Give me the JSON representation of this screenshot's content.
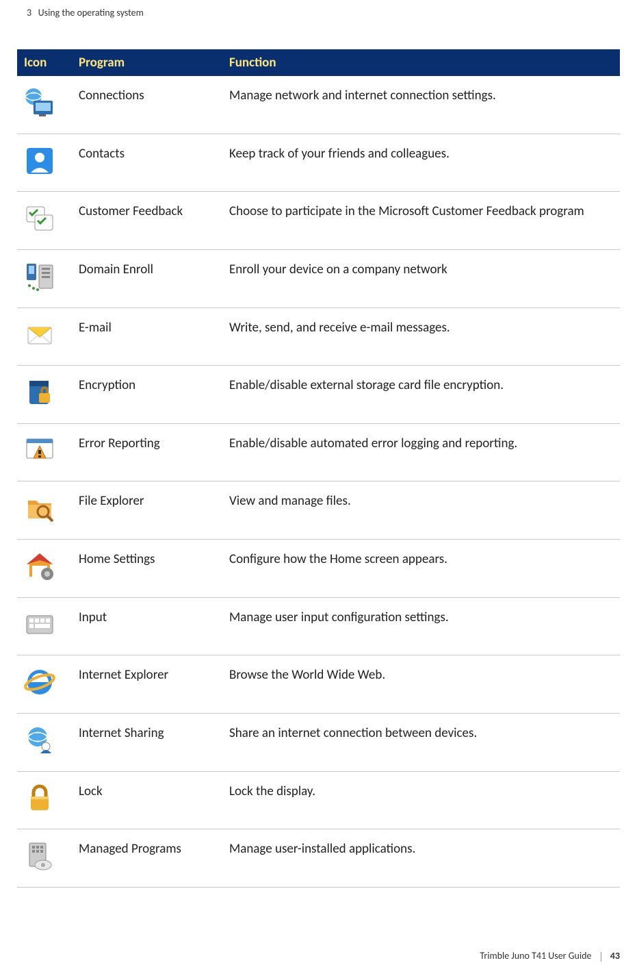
{
  "page": {
    "chapter_num": "3",
    "chapter_title": "Using the  operating system",
    "footer_guide": "Trimble Juno T41 User Guide",
    "page_number": "43"
  },
  "table": {
    "headers": {
      "icon": "Icon",
      "program": "Program",
      "function": "Function"
    },
    "rows": [
      {
        "icon": "connections-icon",
        "program": "Connections",
        "function": "Manage network and internet connection settings."
      },
      {
        "icon": "contacts-icon",
        "program": "Contacts",
        "function": "Keep track of your friends and colleagues."
      },
      {
        "icon": "customer-feedback-icon",
        "program": "Customer Feedback",
        "function": "Choose to participate in the Microsoft Customer Feedback program"
      },
      {
        "icon": "domain-enroll-icon",
        "program": "Domain Enroll",
        "function": "Enroll your device on a company network"
      },
      {
        "icon": "email-icon",
        "program": "E-mail",
        "function": "Write, send, and receive e-mail messages."
      },
      {
        "icon": "encryption-icon",
        "program": "Encryption",
        "function": "Enable/disable external storage card file encryption."
      },
      {
        "icon": "error-reporting-icon",
        "program": "Error Reporting",
        "function": "Enable/disable automated error logging and reporting."
      },
      {
        "icon": "file-explorer-icon",
        "program": "File Explorer",
        "function": "View and manage files."
      },
      {
        "icon": "home-settings-icon",
        "program": "Home Settings",
        "function": "Configure how the Home screen appears."
      },
      {
        "icon": "input-icon",
        "program": "Input",
        "function": "Manage user input configuration settings."
      },
      {
        "icon": "internet-explorer-icon",
        "program": "Internet Explorer",
        "function": "Browse the World Wide Web."
      },
      {
        "icon": "internet-sharing-icon",
        "program": "Internet Sharing",
        "function": "Share an internet connection between devices."
      },
      {
        "icon": "lock-icon",
        "program": "Lock",
        "function": "Lock the display."
      },
      {
        "icon": "managed-programs-icon",
        "program": "Managed Programs",
        "function": "Manage user-installed applications."
      }
    ]
  }
}
